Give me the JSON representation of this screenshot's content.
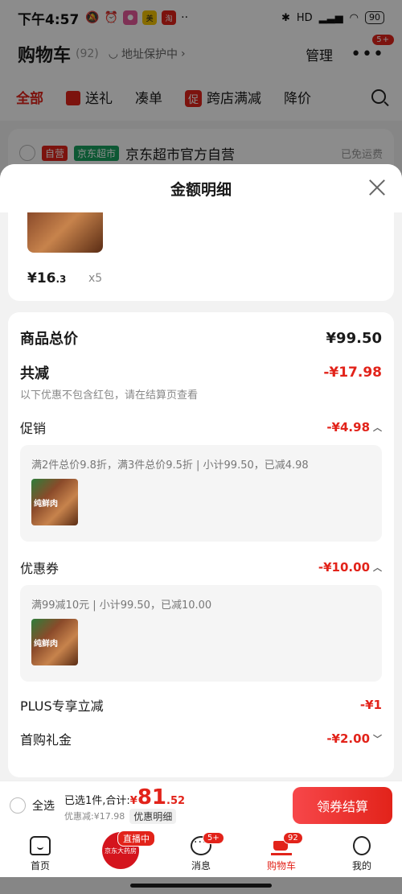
{
  "status": {
    "time": "下午4:57",
    "network": "HD",
    "battery": "90"
  },
  "header": {
    "title": "购物车",
    "count": "(92)",
    "address_protect": "地址保护中",
    "manage": "管理",
    "more_badge": "5+"
  },
  "filters": {
    "all": "全部",
    "gift": "送礼",
    "combine": "凑单",
    "promo_tag": "促",
    "cross_store": "跨店满减",
    "price_drop": "降价"
  },
  "store": {
    "self_tag": "自营",
    "jd_tag": "京东超市",
    "name": "京东超市官方自营",
    "free_shipping": "已免运费"
  },
  "sheet": {
    "title": "金额明细",
    "product": {
      "price_int": "¥16",
      "price_dec": ".3",
      "qty": "x5"
    },
    "total_label": "商品总价",
    "total_value": "¥99.50",
    "discount_label": "共减",
    "discount_value": "-¥17.98",
    "note": "以下优惠不包含红包，请在结算页查看",
    "promotion": {
      "label": "促销",
      "value": "-¥4.98",
      "desc": "满2件总价9.8折，满3件总价9.5折 | 小计99.50，已减4.98"
    },
    "coupon": {
      "label": "优惠券",
      "value": "-¥10.00",
      "desc": "满99减10元 | 小计99.50，已减10.00"
    },
    "plus": {
      "label": "PLUS专享立减",
      "value": "-¥1"
    },
    "first_gift": {
      "label": "首购礼金",
      "value": "-¥2.00"
    },
    "thumb_text": "纯鲜肉"
  },
  "checkout": {
    "select_all": "全选",
    "selected": "已选1件,合计:",
    "total_symbol": "¥",
    "total_int": "81",
    "total_dec": ".52",
    "discount": "优惠减:¥17.98",
    "detail_link": "优惠明细",
    "button": "领券结算"
  },
  "tabbar": {
    "home": "首页",
    "live_tag": "直播中",
    "live_name": "京东大药房",
    "messages": "消息",
    "messages_badge": "5+",
    "cart": "购物车",
    "cart_badge": "92",
    "me": "我的"
  },
  "colors": {
    "accent": "#e2231a",
    "jd_green": "#19a15f"
  }
}
